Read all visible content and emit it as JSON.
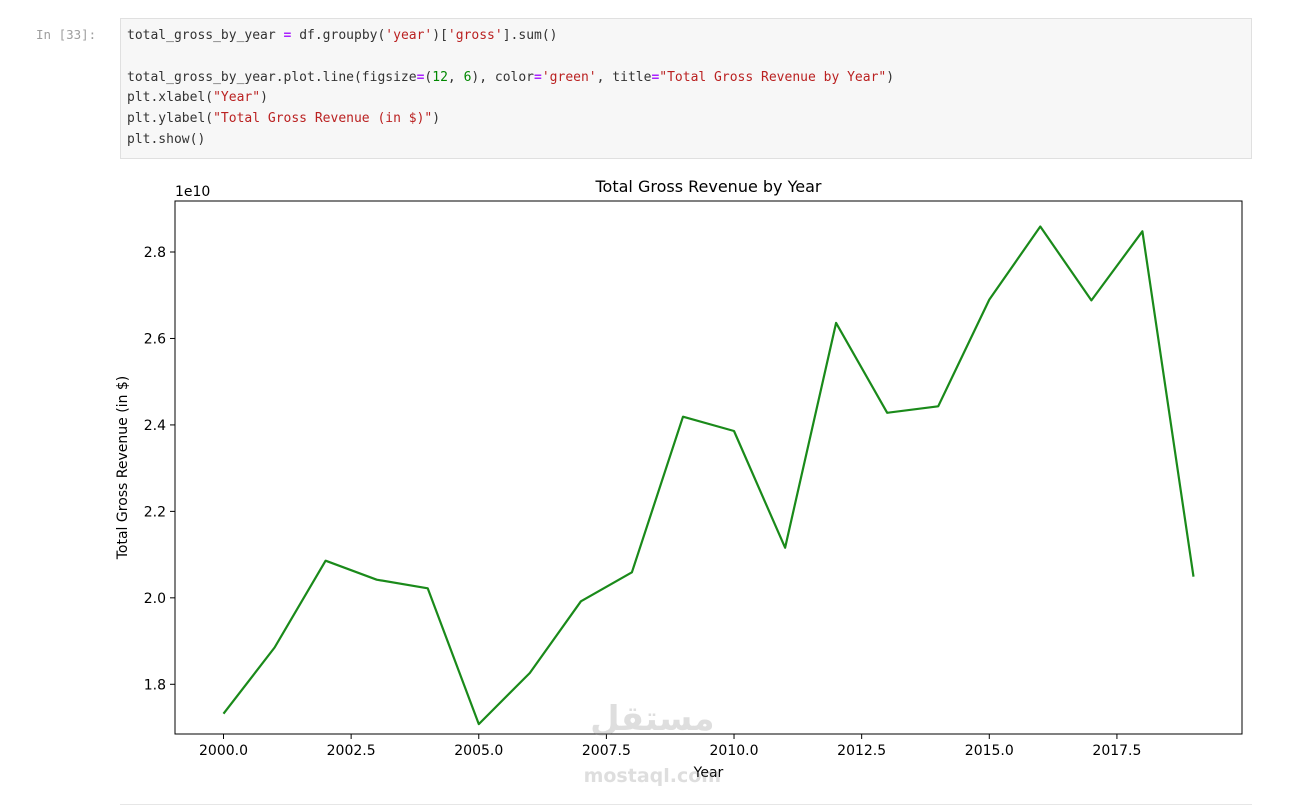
{
  "cell": {
    "prompt": "In [33]:",
    "code_lines": [
      [
        {
          "t": "total_gross_by_year ",
          "c": ""
        },
        {
          "t": "=",
          "c": "op"
        },
        {
          "t": " df.groupby(",
          "c": ""
        },
        {
          "t": "'year'",
          "c": "str"
        },
        {
          "t": ")[",
          "c": ""
        },
        {
          "t": "'gross'",
          "c": "str"
        },
        {
          "t": "].sum()",
          "c": ""
        }
      ],
      [],
      [
        {
          "t": "total_gross_by_year.plot.line(figsize",
          "c": ""
        },
        {
          "t": "=",
          "c": "op"
        },
        {
          "t": "(",
          "c": ""
        },
        {
          "t": "12",
          "c": "num"
        },
        {
          "t": ", ",
          "c": ""
        },
        {
          "t": "6",
          "c": "num"
        },
        {
          "t": "), color",
          "c": ""
        },
        {
          "t": "=",
          "c": "op"
        },
        {
          "t": "'green'",
          "c": "str"
        },
        {
          "t": ", title",
          "c": ""
        },
        {
          "t": "=",
          "c": "op"
        },
        {
          "t": "\"Total Gross Revenue by Year\"",
          "c": "str"
        },
        {
          "t": ")",
          "c": ""
        }
      ],
      [
        {
          "t": "plt.xlabel(",
          "c": ""
        },
        {
          "t": "\"Year\"",
          "c": "str"
        },
        {
          "t": ")",
          "c": ""
        }
      ],
      [
        {
          "t": "plt.ylabel(",
          "c": ""
        },
        {
          "t": "\"Total Gross Revenue (in $)\"",
          "c": "str"
        },
        {
          "t": ")",
          "c": ""
        }
      ],
      [
        {
          "t": "plt.show()",
          "c": ""
        }
      ]
    ]
  },
  "chart_data": {
    "type": "line",
    "title": "Total Gross Revenue by Year",
    "xlabel": "Year",
    "ylabel": "Total Gross Revenue (in $)",
    "y_offset_text": "1e10",
    "xlim": [
      1999.05,
      2019.95
    ],
    "ylim": [
      1.685,
      2.918
    ],
    "x_ticks": [
      2000.0,
      2002.5,
      2005.0,
      2007.5,
      2010.0,
      2012.5,
      2015.0,
      2017.5
    ],
    "x_tick_labels": [
      "2000.0",
      "2002.5",
      "2005.0",
      "2007.5",
      "2010.0",
      "2012.5",
      "2015.0",
      "2017.5"
    ],
    "y_ticks": [
      1.8,
      2.0,
      2.2,
      2.4,
      2.6,
      2.8
    ],
    "y_tick_labels": [
      "1.8",
      "2.0",
      "2.2",
      "2.4",
      "2.6",
      "2.8"
    ],
    "grid": false,
    "series_color": "#1a8a1a",
    "x": [
      2000,
      2001,
      2002,
      2003,
      2004,
      2005,
      2006,
      2007,
      2008,
      2009,
      2010,
      2011,
      2012,
      2013,
      2014,
      2015,
      2016,
      2017,
      2018,
      2019
    ],
    "values": [
      1.732,
      1.885,
      2.086,
      2.042,
      2.022,
      1.708,
      1.826,
      1.992,
      2.059,
      2.419,
      2.386,
      2.116,
      2.636,
      2.428,
      2.443,
      2.69,
      2.859,
      2.688,
      2.848,
      2.049
    ]
  },
  "watermark": {
    "text": "mostaql.com",
    "arabic": "مستقل"
  }
}
